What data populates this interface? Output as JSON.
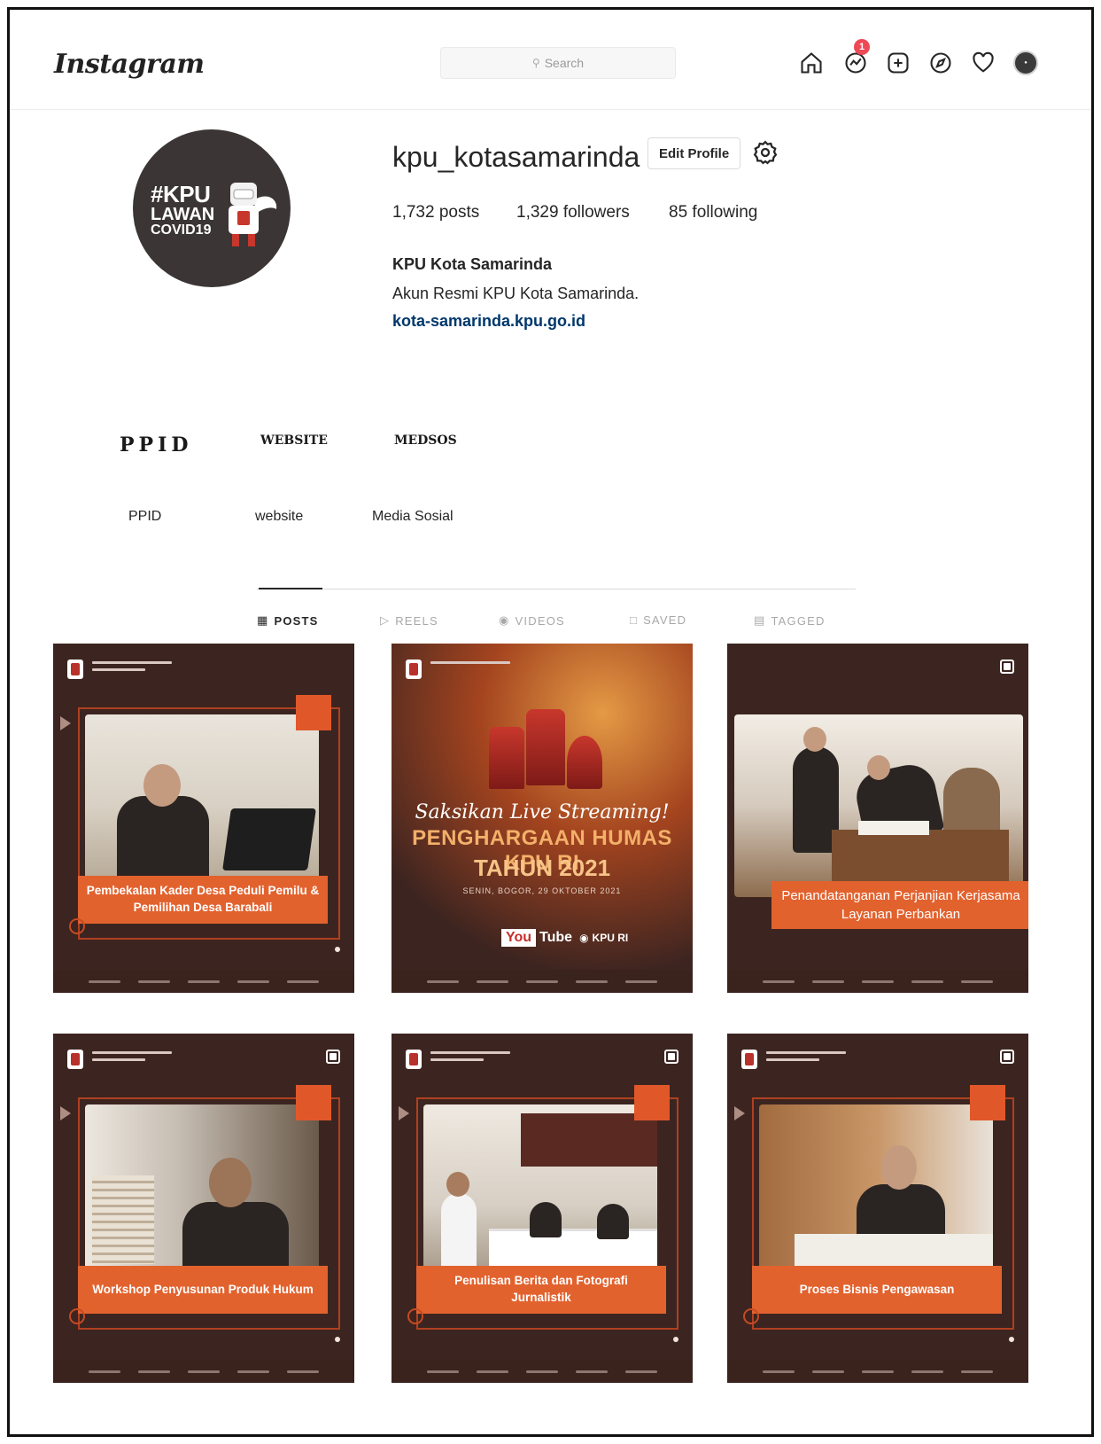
{
  "app": {
    "logo": "Instagram"
  },
  "topnav": {
    "search_placeholder": "Search",
    "notification_count": "1",
    "icons": [
      "home-icon",
      "activity-icon",
      "new-post-icon",
      "explore-icon",
      "heart-icon",
      "profile-avatar"
    ]
  },
  "profile": {
    "avatar_text": {
      "line1": "#KPU",
      "line2": "LAWAN",
      "line3": "COVID19"
    },
    "username": "kpu_kotasamarinda",
    "edit_profile_label": "Edit Profile",
    "stats": {
      "posts": "1,732 posts",
      "followers": "1,329 followers",
      "following": "85 following"
    },
    "full_name": "KPU Kota Samarinda",
    "bio": "Akun Resmi KPU Kota Samarinda.",
    "link": "kota-samarinda.kpu.go.id"
  },
  "highlights": [
    {
      "cover": "PPID",
      "label": "PPID"
    },
    {
      "cover": "WEBSITE",
      "label": "website"
    },
    {
      "cover": "MEDSOS",
      "label": "Media Sosial"
    }
  ],
  "tabs": [
    {
      "label": "POSTS",
      "icon": "grid-icon",
      "active": true
    },
    {
      "label": "REELS",
      "icon": "reels-icon",
      "active": false
    },
    {
      "label": "VIDEOS",
      "icon": "video-icon",
      "active": false
    },
    {
      "label": "SAVED",
      "icon": "bookmark-icon",
      "active": false
    },
    {
      "label": "TAGGED",
      "icon": "tag-icon",
      "active": false
    }
  ],
  "posts": [
    {
      "caption": "Pembekalan Kader Desa Peduli Pemilu & Pemilihan Desa Barabali"
    },
    {
      "poster_script": "Saksikan Live Streaming!",
      "poster_title": "PENGHARGAAN HUMAS KPU RI",
      "poster_year": "TAHUN 2021",
      "poster_sub": "SENIN, BOGOR, 29 OKTOBER 2021",
      "poster_yt_logo": "You",
      "poster_yt_word": "Tube",
      "poster_yt_channel": "KPU RI"
    },
    {
      "caption": "Penandatanganan Perjanjian Kerjasama Layanan Perbankan"
    },
    {
      "caption": "Workshop Penyusunan Produk Hukum"
    },
    {
      "caption": "Penulisan Berita dan Fotografi Jurnalistik"
    },
    {
      "caption": "Proses Bisnis Pengawasan"
    }
  ],
  "colors": {
    "post_bg": "#3c2520",
    "accent_orange": "#e2622e",
    "link_blue": "#00376b",
    "badge_red": "#ed4956"
  }
}
